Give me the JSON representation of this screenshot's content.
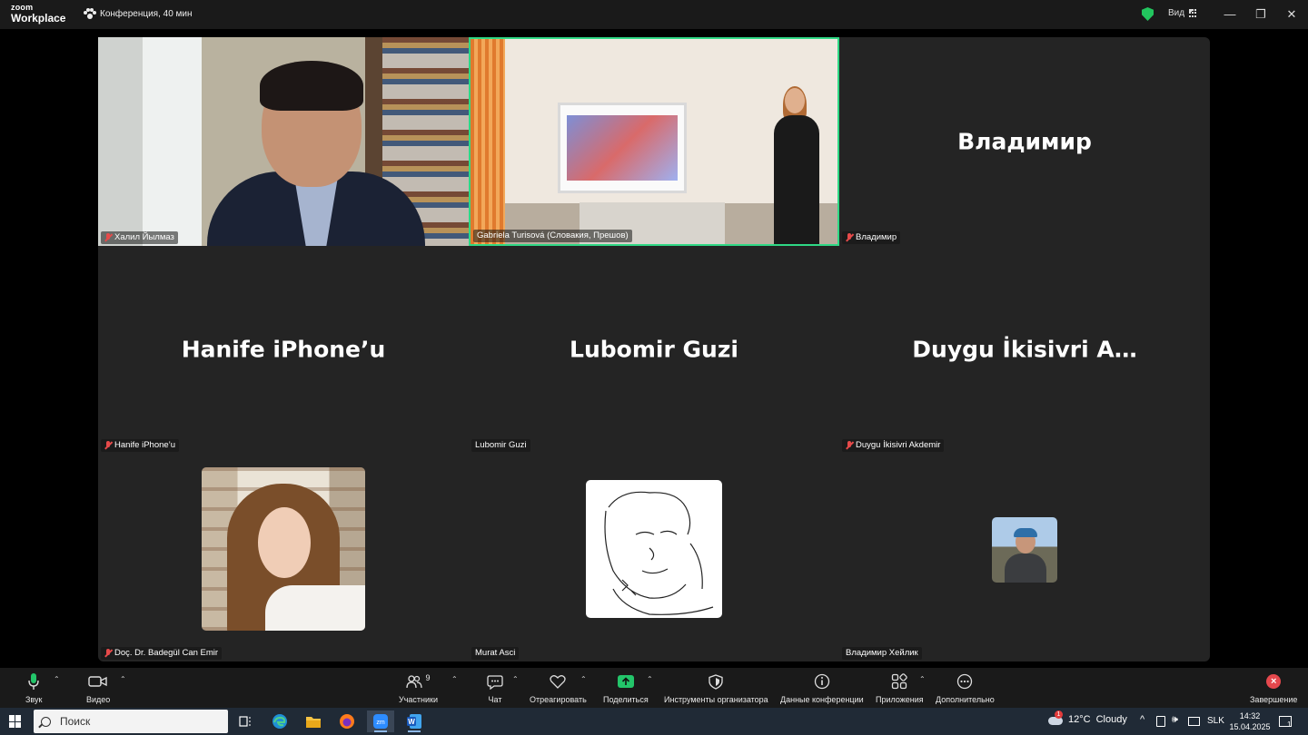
{
  "titlebar": {
    "logo_line1": "zoom",
    "logo_line2": "Workplace",
    "meeting_title": "Конференция, 40 мин",
    "view_label": "Вид",
    "minimize": "—",
    "restore": "❐",
    "close": "✕"
  },
  "tiles": [
    {
      "id": "khalil",
      "name": "Халил Йылмаз",
      "muted": true,
      "kind": "video"
    },
    {
      "id": "gabriela",
      "name": "Gabriela Turisová (Словакия, Прешов)",
      "muted": false,
      "kind": "video",
      "active_speaker": true
    },
    {
      "id": "vladimir",
      "name": "Владимир",
      "display_name": "Владимир",
      "muted": true,
      "kind": "name"
    },
    {
      "id": "hanife",
      "name": "Hanife iPhone’u",
      "display_name": "Hanife iPhone’u",
      "muted": true,
      "kind": "name"
    },
    {
      "id": "lubomir",
      "name": "Lubomir Guzi",
      "display_name": "Lubomir Guzi",
      "muted": false,
      "kind": "name"
    },
    {
      "id": "duygu",
      "name": "Duygu İkisivri Akdemir",
      "display_name": "Duygu  İkisivri  A…",
      "muted": true,
      "kind": "name"
    },
    {
      "id": "badegul",
      "name": "Doç. Dr. Badegül Can Emir",
      "muted": true,
      "kind": "avatar"
    },
    {
      "id": "murat",
      "name": "Murat Asci",
      "muted": false,
      "kind": "avatar"
    },
    {
      "id": "vladimir_h",
      "name": "Владимир Хейлик",
      "muted": false,
      "kind": "avatar"
    }
  ],
  "toolbar": {
    "audio": "Звук",
    "video": "Видео",
    "participants": "Участники",
    "participants_count": "9",
    "chat": "Чат",
    "react": "Отреагировать",
    "share": "Поделиться",
    "host_tools": "Инструменты организатора",
    "meeting_info": "Данные конференции",
    "apps": "Приложения",
    "more": "Дополнительно",
    "leave": "Завершение"
  },
  "taskbar": {
    "search_placeholder": "Поиск",
    "weather_temp": "12°C",
    "weather_text": "Cloudy",
    "weather_badge": "1",
    "language": "SLK",
    "time": "14:32",
    "date": "15.04.2025",
    "notification_count": "1"
  },
  "colors": {
    "active_speaker_border": "#2fd885",
    "muted_mic": "#e64a4a",
    "share_green": "#23c56a",
    "leave_red": "#e5484d"
  }
}
